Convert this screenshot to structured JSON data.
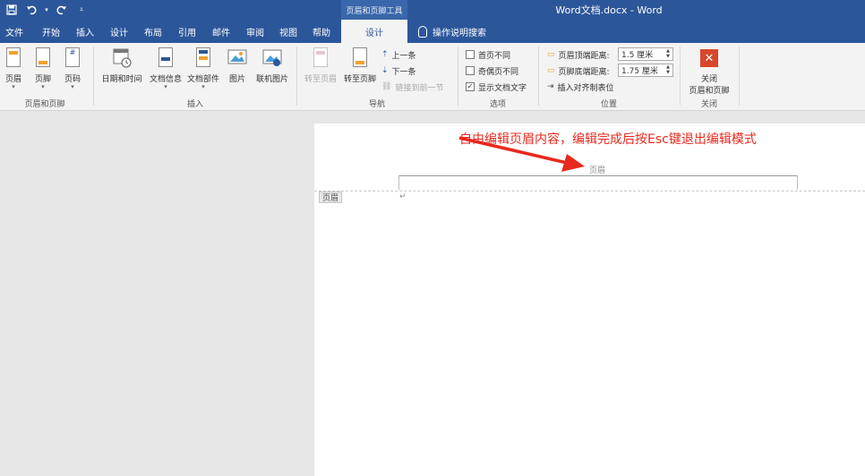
{
  "window": {
    "doc_title": "Word文档.docx - Word",
    "context_tab_title": "页眉和页脚工具"
  },
  "qat": {
    "save_icon": "save-icon",
    "undo_icon": "undo-icon",
    "redo_icon": "redo-icon",
    "customize_icon": "customize-icon"
  },
  "menu": {
    "items": [
      "文件",
      "开始",
      "插入",
      "设计",
      "布局",
      "引用",
      "邮件",
      "审阅",
      "视图",
      "帮助"
    ],
    "active": "设计",
    "tell_me": "操作说明搜索"
  },
  "ribbon": {
    "group1": {
      "label": "页眉和页脚",
      "buttons": [
        "页眉",
        "页脚",
        "页码"
      ]
    },
    "group2": {
      "label": "插入",
      "buttons": [
        "日期和时间",
        "文档信息",
        "文档部件",
        "图片",
        "联机图片"
      ]
    },
    "group3": {
      "label": "导航",
      "buttons": [
        "转至页眉",
        "转至页脚"
      ],
      "small": [
        "上一条",
        "下一条",
        "链接到前一节"
      ]
    },
    "group4": {
      "label": "选项",
      "checks": [
        "首页不同",
        "奇偶页不同",
        "显示文档文字"
      ],
      "checked": [
        false,
        false,
        true
      ]
    },
    "group5": {
      "label": "位置",
      "header_distance_label": "页眉顶端距离:",
      "header_distance_value": "1.5 厘米",
      "footer_distance_label": "页脚底端距离:",
      "footer_distance_value": "1.75 厘米",
      "insert_tab": "插入对齐制表位"
    },
    "group6": {
      "label": "关闭",
      "button_line1": "关闭",
      "button_line2": "页眉和页脚"
    }
  },
  "document": {
    "header_text": "页眉",
    "header_tag": "页眉",
    "paragraph_mark": "↵",
    "annotation": "自由编辑页眉内容，编辑完成后按Esc键退出编辑模式"
  },
  "colors": {
    "title_bar": "#2b579a",
    "annotation": "#e8291e",
    "close_button": "#d9472b"
  }
}
